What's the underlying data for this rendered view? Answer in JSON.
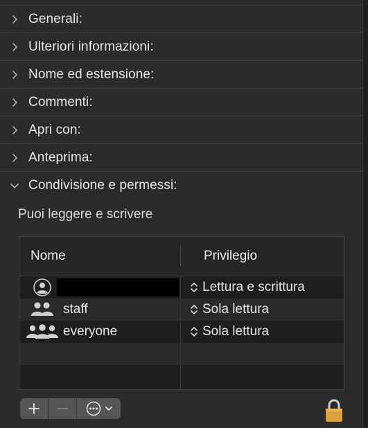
{
  "sections": [
    {
      "label": "Generali:",
      "expanded": false
    },
    {
      "label": "Ulteriori informazioni:",
      "expanded": false
    },
    {
      "label": "Nome ed estensione:",
      "expanded": false
    },
    {
      "label": "Commenti:",
      "expanded": false
    },
    {
      "label": "Apri con:",
      "expanded": false
    },
    {
      "label": "Anteprima:",
      "expanded": false
    },
    {
      "label": "Condivisione e permessi:",
      "expanded": true
    }
  ],
  "sharing": {
    "info_text": "Puoi leggere e scrivere",
    "columns": {
      "name": "Nome",
      "privilege": "Privilegio"
    },
    "rows": [
      {
        "icon": "single-user-icon",
        "name": "",
        "privilege": "Lettura e scrittura"
      },
      {
        "icon": "group-icon",
        "name": "staff",
        "privilege": "Sola lettura"
      },
      {
        "icon": "everyone-icon",
        "name": "everyone",
        "privilege": "Sola lettura"
      }
    ]
  },
  "toolbar": {
    "add_icon": "plus-icon",
    "remove_icon": "minus-icon",
    "action_icon": "ellipsis-circle-icon"
  },
  "lock_icon": "lock-icon",
  "colors": {
    "background": "#2b2b2b",
    "table_bg": "#1e1e1e",
    "lock": "#d9a23a"
  }
}
